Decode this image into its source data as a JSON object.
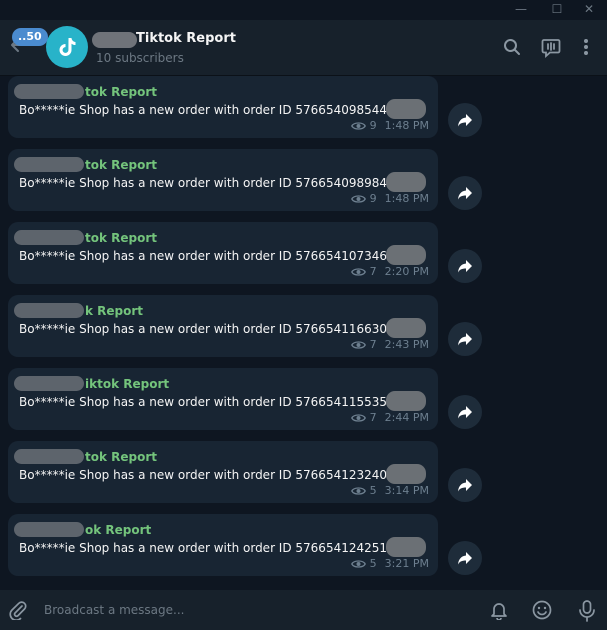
{
  "window": {
    "minimize": "—",
    "maximize": "☐",
    "close": "✕"
  },
  "header": {
    "unread_count": "..50",
    "channel_name": "Tiktok Report",
    "subscribers": "10 subscribers",
    "icons": [
      "search-icon",
      "live-stream-icon",
      "more-vertical-icon"
    ]
  },
  "messages": [
    {
      "sender_suffix": "tok Report",
      "text": "Bo*****ie Shop has a new order with order ID 576654098544",
      "views": "9",
      "time": "1:48 PM"
    },
    {
      "sender_suffix": "tok Report",
      "text": "Bo*****ie Shop has a new order with order ID 5766540989845",
      "views": "9",
      "time": "1:48 PM"
    },
    {
      "sender_suffix": "tok Report",
      "text": "Bo*****ie Shop has a new order with order ID 5766541073463",
      "views": "7",
      "time": "2:20 PM"
    },
    {
      "sender_suffix": "k Report",
      "text": "Bo*****ie Shop has a new order with order ID 5766541166302",
      "views": "7",
      "time": "2:43 PM"
    },
    {
      "sender_suffix": "iktok Report",
      "text": "Bo*****ie Shop has a new order with order ID 576654115535",
      "views": "7",
      "time": "2:44 PM"
    },
    {
      "sender_suffix": "tok Report",
      "text": "Bo*****ie Shop has a new order with order ID 576654123240",
      "views": "5",
      "time": "3:14 PM"
    },
    {
      "sender_suffix": "ok Report",
      "text": "Bo*****ie Shop has a new order with order ID 576654124251",
      "views": "5",
      "time": "3:21 PM"
    }
  ],
  "compose": {
    "placeholder": "Broadcast a message...",
    "icons": [
      "attach-icon",
      "bell-icon",
      "emoji-icon",
      "microphone-icon"
    ]
  },
  "colors": {
    "background": "#0e1621",
    "header": "#17212b",
    "bubble": "#182533",
    "sender": "#74c47c",
    "accent": "#4a8bcf",
    "avatar": "#28b3c9"
  }
}
